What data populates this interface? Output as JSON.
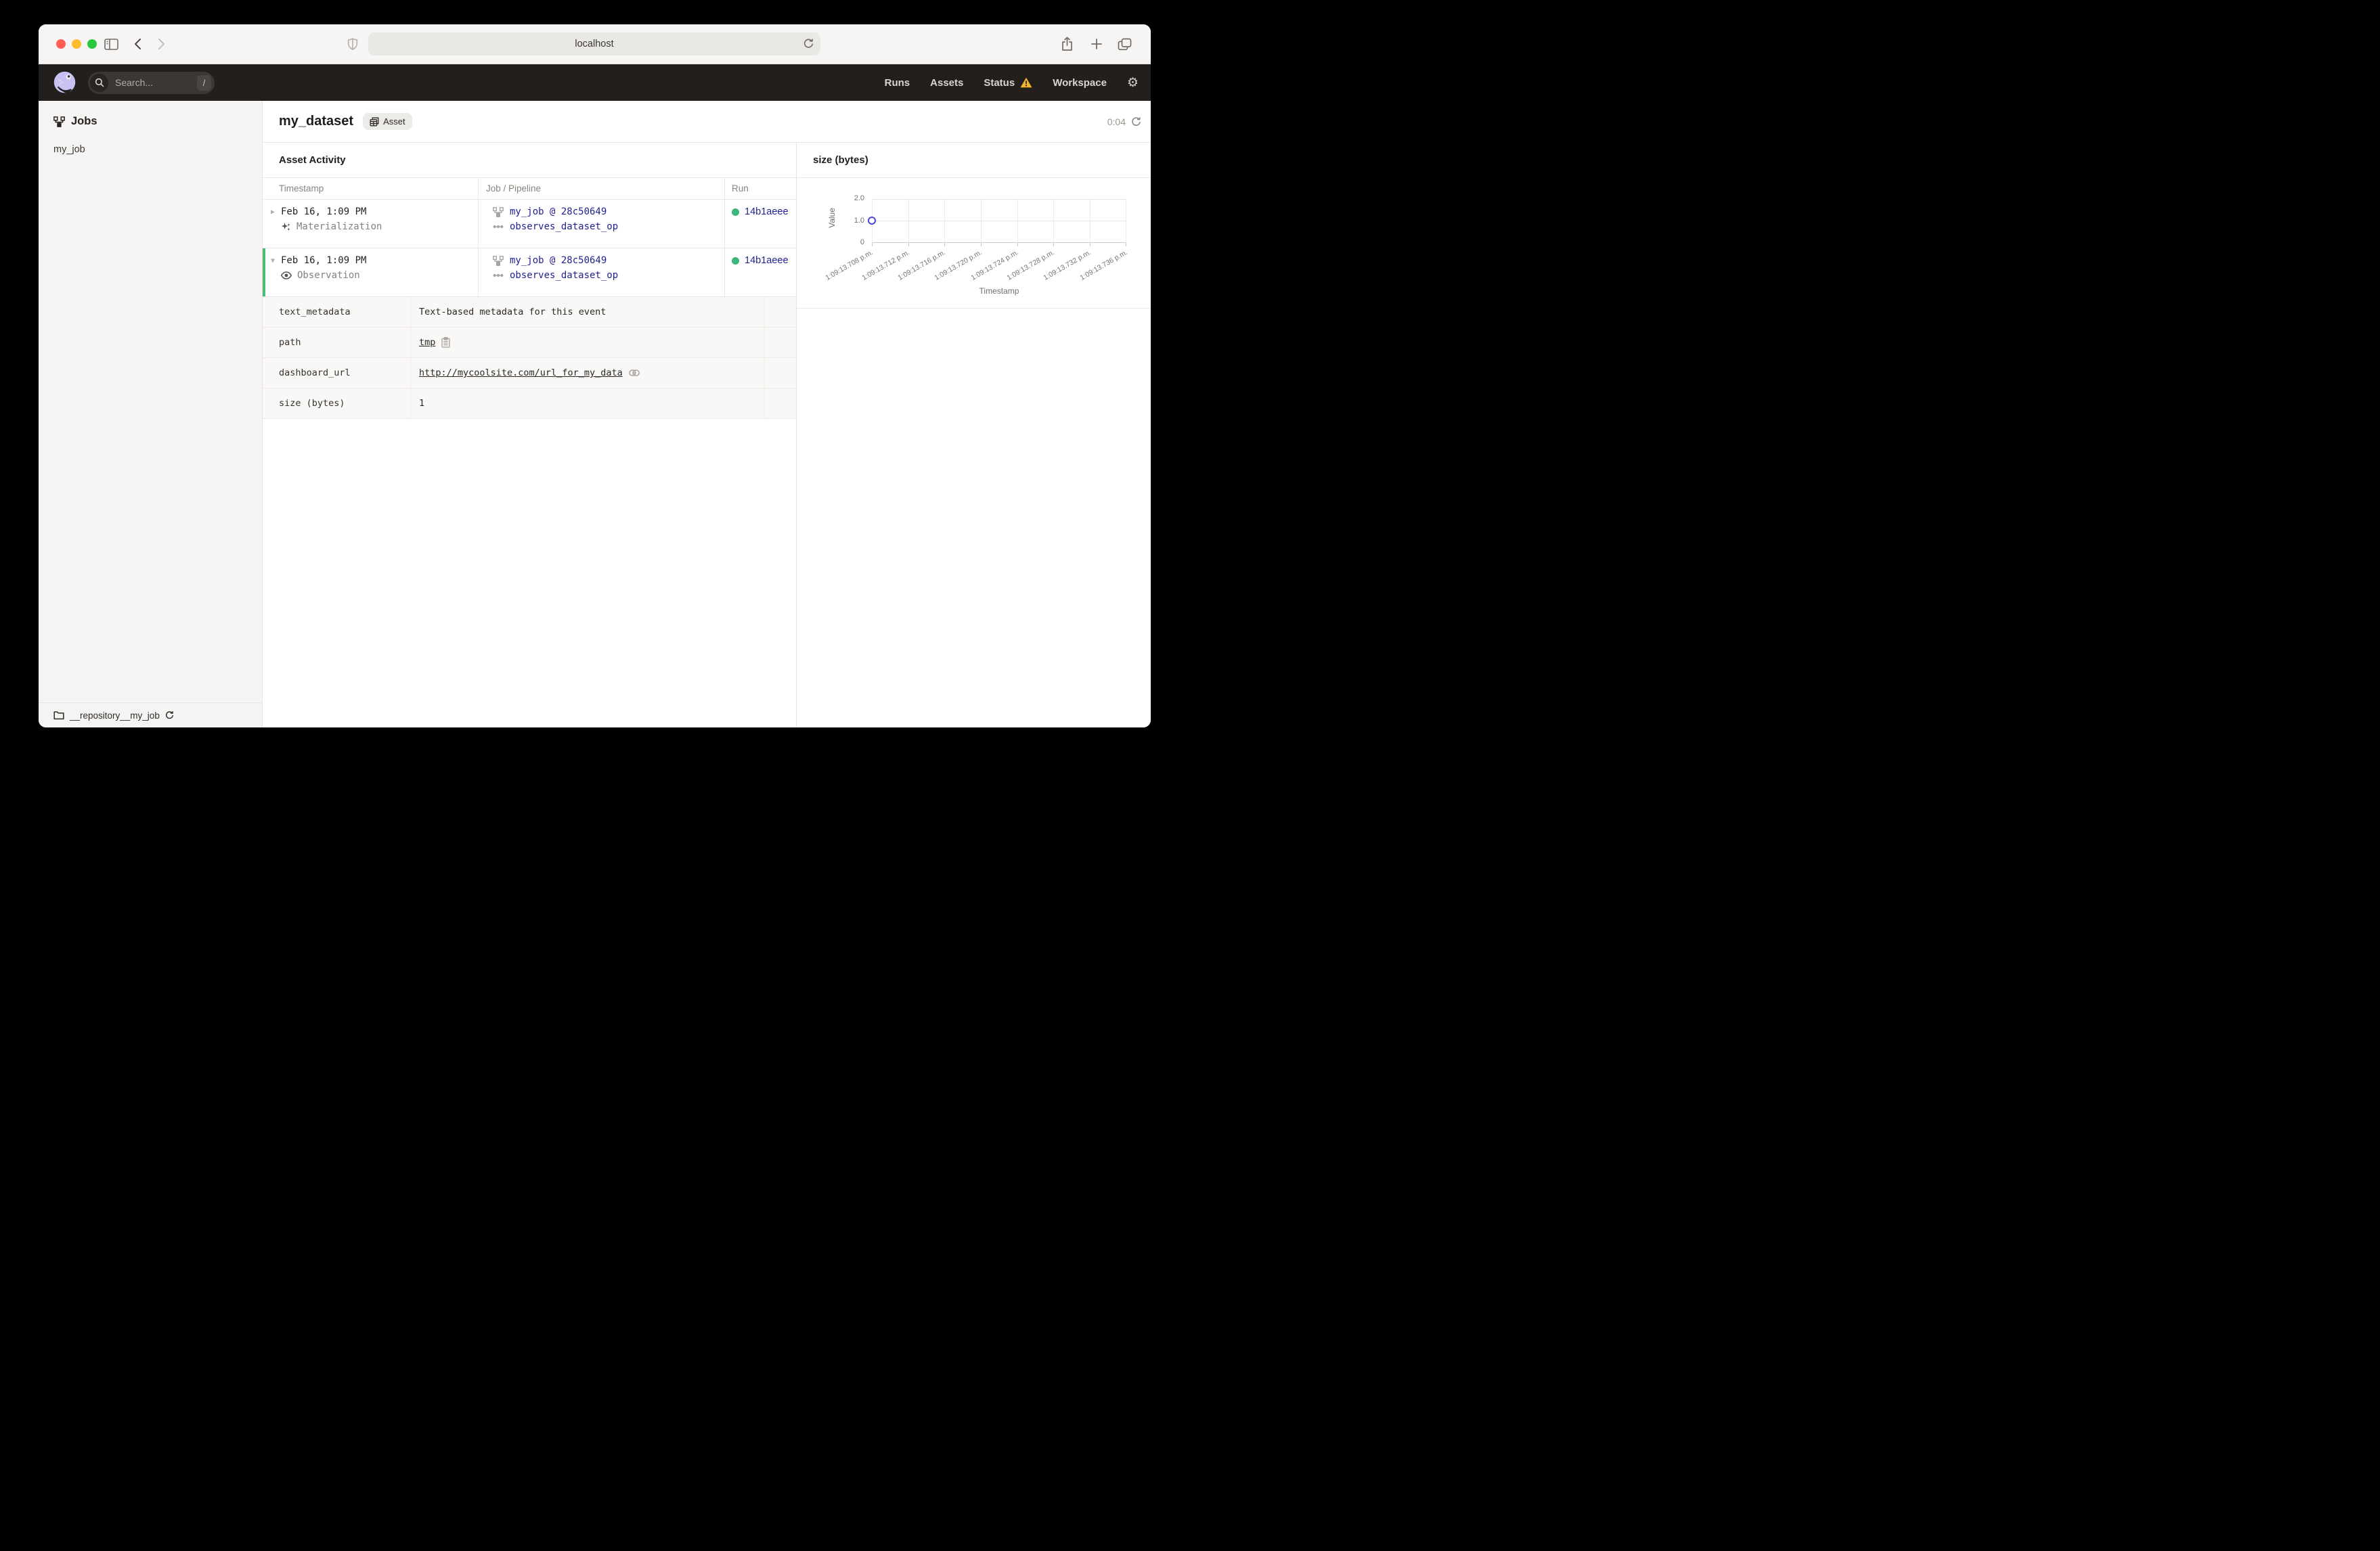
{
  "browser": {
    "url": "localhost"
  },
  "app_header": {
    "search_placeholder": "Search...",
    "search_shortcut": "/",
    "nav": [
      {
        "label": "Runs"
      },
      {
        "label": "Assets"
      },
      {
        "label": "Status"
      },
      {
        "label": "Workspace"
      }
    ]
  },
  "sidebar": {
    "section_title": "Jobs",
    "job": "my_job",
    "repository": "__repository__my_job"
  },
  "page": {
    "title": "my_dataset",
    "badge": "Asset",
    "timer": "0:04"
  },
  "activity": {
    "title": "Asset Activity",
    "columns": [
      "Timestamp",
      "Job / Pipeline",
      "Run"
    ],
    "rows": [
      {
        "timestamp": "Feb 16, 1:09 PM",
        "event_type": "Materialization",
        "job_link": "my_job @ 28c50649",
        "op_link": "observes_dataset_op",
        "run_id": "14b1aeee",
        "run_status": "success",
        "expanded": false
      },
      {
        "timestamp": "Feb 16, 1:09 PM",
        "event_type": "Observation",
        "job_link": "my_job @ 28c50649",
        "op_link": "observes_dataset_op",
        "run_id": "14b1aeee",
        "run_status": "success",
        "expanded": true
      }
    ],
    "metadata": [
      {
        "key": "text_metadata",
        "value": "Text-based metadata for this event"
      },
      {
        "key": "path",
        "value": "tmp"
      },
      {
        "key": "dashboard_url",
        "value": "http://mycoolsite.com/url_for_my_data"
      },
      {
        "key": "size (bytes)",
        "value": "1"
      }
    ]
  },
  "chart_data": {
    "type": "scatter",
    "title": "size (bytes)",
    "xlabel": "Timestamp",
    "ylabel": "Value",
    "ylim": [
      0,
      2
    ],
    "yticks": [
      "2.0",
      "1.0",
      "0"
    ],
    "grid": true,
    "xticks": [
      "1:09:13.708 p.m.",
      "1:09:13.712 p.m.",
      "1:09:13.716 p.m.",
      "1:09:13.720 p.m.",
      "1:09:13.724 p.m.",
      "1:09:13.728 p.m.",
      "1:09:13.732 p.m.",
      "1:09:13.736 p.m."
    ],
    "points": [
      {
        "x": "1:09:13.708 p.m.",
        "y": 1
      }
    ]
  },
  "colors": {
    "link_navy": "#201f90",
    "success_green": "#3eb77f",
    "expanded_row_accent": "#4cbb79",
    "warning_yellow": "#f0b32e",
    "point_indigo": "#4b45d2",
    "header_dark": "#231f1d"
  }
}
